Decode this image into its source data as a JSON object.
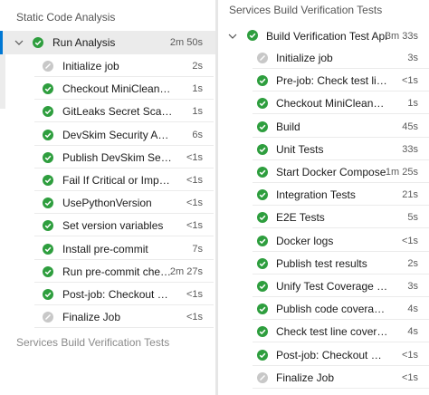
{
  "left": {
    "title": "Static Code Analysis",
    "job": {
      "label": "Run Analysis",
      "duration": "2m 50s"
    },
    "steps": [
      {
        "label": "Initialize job",
        "duration": "2s",
        "status": "skip"
      },
      {
        "label": "Checkout MiniClean@main to s",
        "duration": "1s",
        "status": "ok"
      },
      {
        "label": "GitLeaks Secret Scanning",
        "duration": "1s",
        "status": "ok"
      },
      {
        "label": "DevSkim Security Analysis",
        "duration": "6s",
        "status": "ok"
      },
      {
        "label": "Publish DevSkim Security Ana...",
        "duration": "<1s",
        "status": "ok"
      },
      {
        "label": "Fail If Critical or Important Se...",
        "duration": "<1s",
        "status": "ok"
      },
      {
        "label": "UsePythonVersion",
        "duration": "<1s",
        "status": "ok"
      },
      {
        "label": "Set version variables",
        "duration": "<1s",
        "status": "ok"
      },
      {
        "label": "Install pre-commit",
        "duration": "7s",
        "status": "ok"
      },
      {
        "label": "Run pre-commit checks",
        "duration": "2m 27s",
        "status": "ok"
      },
      {
        "label": "Post-job: Checkout MiniClean...",
        "duration": "<1s",
        "status": "ok"
      },
      {
        "label": "Finalize Job",
        "duration": "<1s",
        "status": "skip"
      }
    ],
    "bottom_title": "Services Build Verification Tests"
  },
  "right": {
    "title": "Services Build Verification Tests",
    "job": {
      "label": "Build Verification Test Api",
      "duration": "3m 33s"
    },
    "steps": [
      {
        "label": "Initialize job",
        "duration": "3s",
        "status": "skip"
      },
      {
        "label": "Pre-job: Check test line cover...",
        "duration": "<1s",
        "status": "ok"
      },
      {
        "label": "Checkout MiniClean@main to s",
        "duration": "1s",
        "status": "ok"
      },
      {
        "label": "Build",
        "duration": "45s",
        "status": "ok"
      },
      {
        "label": "Unit Tests",
        "duration": "33s",
        "status": "ok"
      },
      {
        "label": "Start Docker Compose",
        "duration": "1m 25s",
        "status": "ok"
      },
      {
        "label": "Integration Tests",
        "duration": "21s",
        "status": "ok"
      },
      {
        "label": "E2E Tests",
        "duration": "5s",
        "status": "ok"
      },
      {
        "label": "Docker logs",
        "duration": "<1s",
        "status": "ok"
      },
      {
        "label": "Publish test results",
        "duration": "2s",
        "status": "ok"
      },
      {
        "label": "Unify Test Coverage Reports",
        "duration": "3s",
        "status": "ok"
      },
      {
        "label": "Publish code coverage results",
        "duration": "4s",
        "status": "ok"
      },
      {
        "label": "Check test line coverage gate",
        "duration": "4s",
        "status": "ok"
      },
      {
        "label": "Post-job: Checkout MiniClean...",
        "duration": "<1s",
        "status": "ok"
      },
      {
        "label": "Finalize Job",
        "duration": "<1s",
        "status": "skip"
      }
    ]
  },
  "colors": {
    "success": "#2e9e3e",
    "skipped": "#c8c8c8",
    "selected_accent": "#0078d4",
    "selected_bg": "#ebebeb"
  },
  "icons": {
    "success": "check-circle-icon",
    "skipped": "skipped-circle-icon",
    "expand": "chevron-down-icon"
  }
}
